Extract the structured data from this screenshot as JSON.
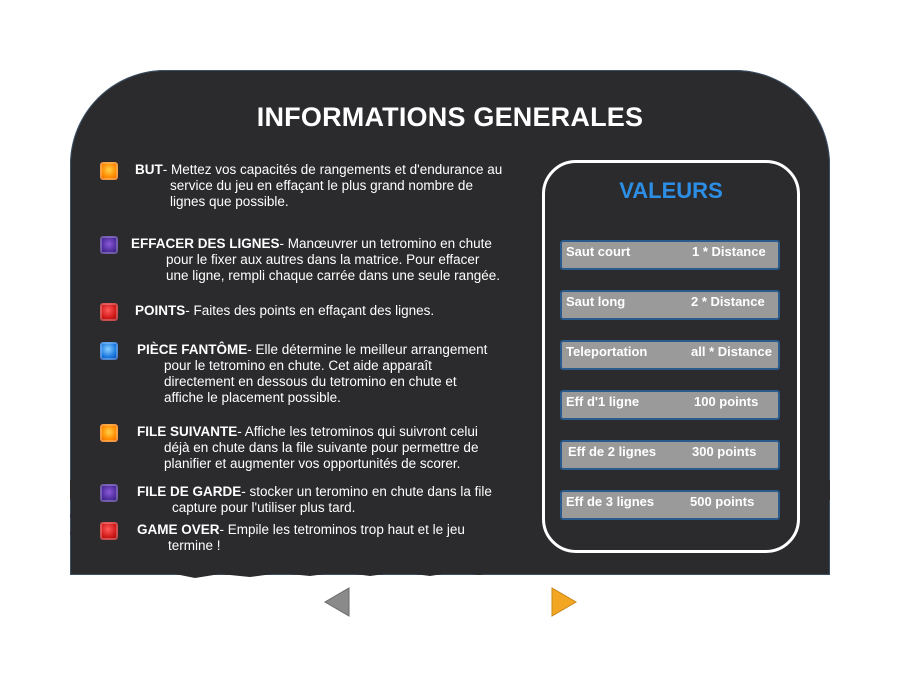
{
  "title": "INFORMATIONS GENERALES",
  "rules": [
    {
      "name": "BUT",
      "color": "orange",
      "lines": [
        "- Mettez vos capacités de rangements et d'endurance au",
        "service du jeu en effaçant le plus grand nombre de",
        "lignes que possible."
      ]
    },
    {
      "name": "EFFACER DES LIGNES",
      "color": "purple",
      "lines": [
        "- Manœuvrer un tetromino en chute",
        "pour le fixer aux autres dans la matrice. Pour effacer",
        "une ligne, rempli chaque carrée dans une seule rangée."
      ]
    },
    {
      "name": "POINTS",
      "color": "red",
      "lines": [
        "- Faites des points en effaçant des lignes."
      ]
    },
    {
      "name": "PIÈCE FANTÔME",
      "color": "blue",
      "lines": [
        "- Elle détermine le meilleur arrangement",
        "pour le tetromino en chute. Cet aide apparaît",
        "directement en dessous du tetromino en chute et",
        "affiche le placement possible."
      ]
    },
    {
      "name": "FILE SUIVANTE",
      "color": "orange",
      "lines": [
        "- Affiche les tetrominos qui suivront celui",
        "déjà en chute dans la file suivante pour permettre de",
        "planifier et augmenter vos opportunités de scorer."
      ]
    },
    {
      "name": "FILE DE GARDE",
      "color": "purple",
      "lines": [
        "- stocker un teromino en chute dans la file",
        "capture pour l'utiliser plus tard."
      ]
    },
    {
      "name": "GAME OVER",
      "color": "red",
      "lines": [
        "- Empile les tetrominos trop haut et le jeu",
        "termine !"
      ]
    }
  ],
  "values": {
    "title": "VALEURS",
    "rows": [
      {
        "label": "Saut court",
        "value": "1 * Distance"
      },
      {
        "label": "Saut long",
        "value": "2 * Distance"
      },
      {
        "label": "Teleportation",
        "value": "all * Distance"
      },
      {
        "label": "Eff d'1 ligne",
        "value": "100 points"
      },
      {
        "label": "Eff de 2 lignes",
        "value": "300 points"
      },
      {
        "label": "Eff de 3 lignes",
        "value": "500 points"
      }
    ]
  },
  "nav": {
    "prev_color": "#8a8a8a",
    "next_color": "#f2a622"
  }
}
